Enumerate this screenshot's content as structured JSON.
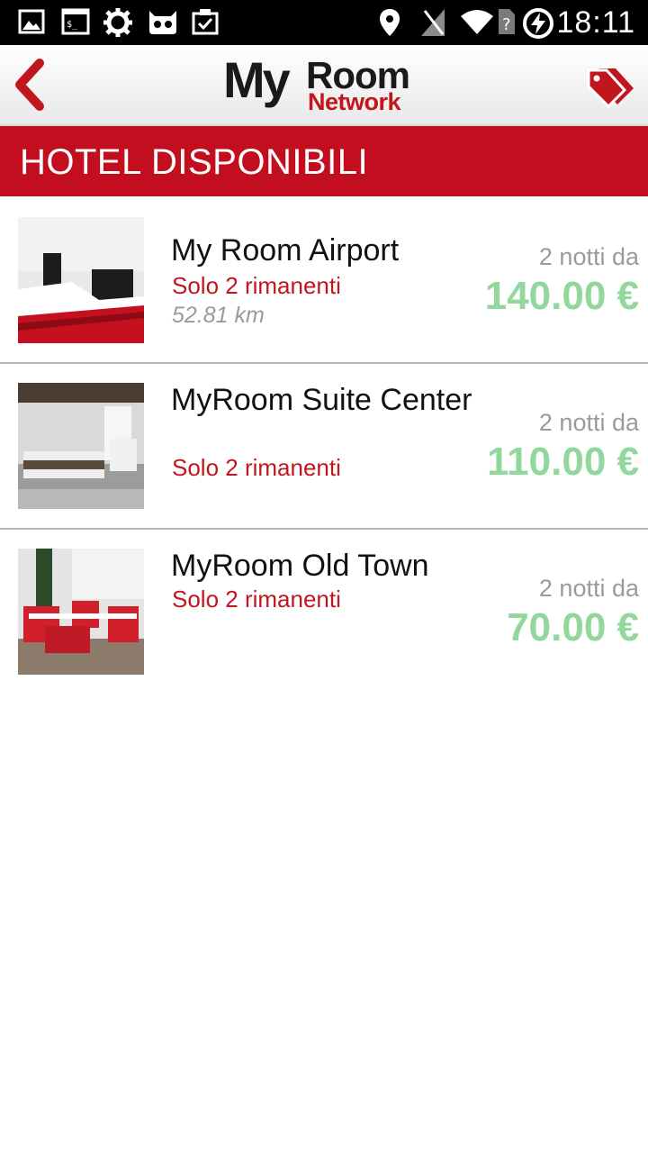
{
  "status_bar": {
    "time": "18:11",
    "left_icons": [
      "image-icon",
      "terminal-icon",
      "settings-gear-icon",
      "cyanogen-android-icon",
      "clipboard-check-icon"
    ],
    "right_icons": [
      "location-pin-icon",
      "signal-muted-icon",
      "wifi-icon",
      "sim-unknown-icon",
      "battery-charging-icon"
    ]
  },
  "app_bar": {
    "logo_my": "My",
    "logo_room": "Room",
    "logo_network": "Network"
  },
  "section": {
    "title": "HOTEL DISPONIBILI"
  },
  "hotels": [
    {
      "name": "My Room Airport",
      "availability": "Solo 2 rimanenti",
      "distance": "52.81 km",
      "nights_label": "2 notti da",
      "price": "140.00 €"
    },
    {
      "name": "MyRoom Suite Center",
      "availability": "Solo 2 rimanenti",
      "nights_label": "2 notti da",
      "price": "110.00 €"
    },
    {
      "name": "MyRoom Old Town",
      "availability": "Solo 2 rimanenti",
      "nights_label": "2 notti da",
      "price": "70.00 €"
    }
  ],
  "colors": {
    "brand_red": "#c20e1e",
    "price_green": "#92d89d",
    "availability_red": "#c2161f"
  }
}
